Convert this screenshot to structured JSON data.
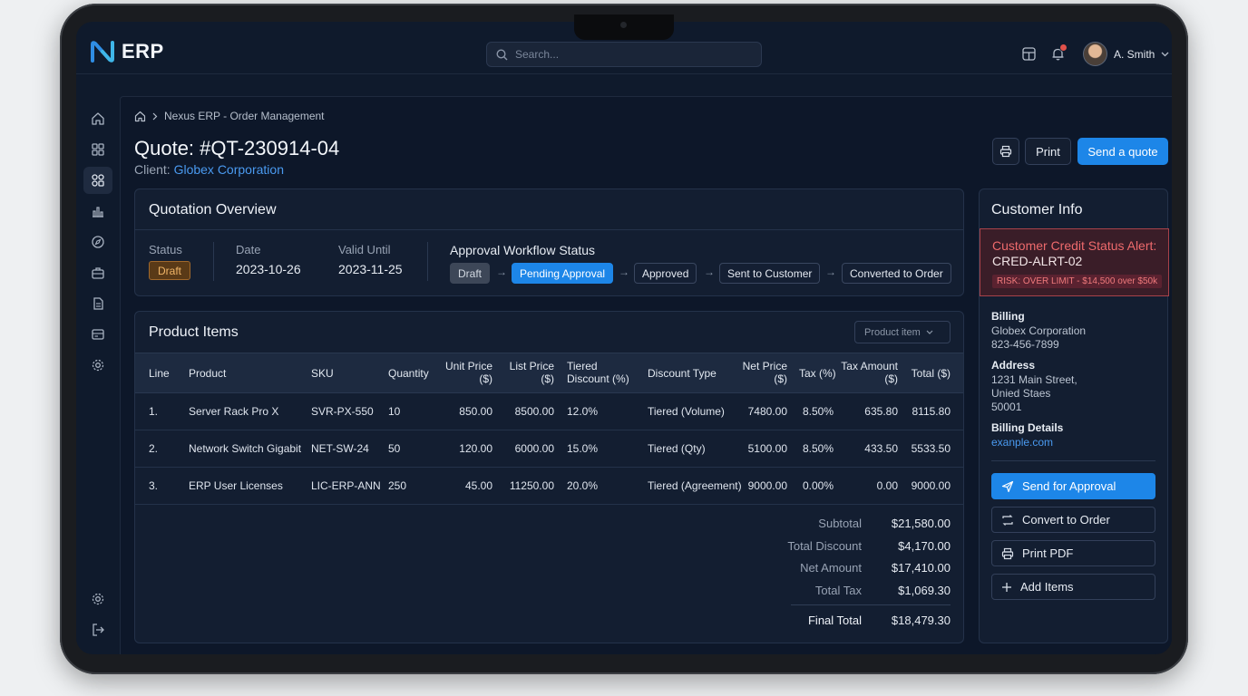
{
  "app": {
    "logo_text": "ERP"
  },
  "search": {
    "placeholder": "Search..."
  },
  "user": {
    "name": "A. Smith"
  },
  "breadcrumb": {
    "label": "Nexus ERP - Order Management"
  },
  "quote": {
    "title": "Quote: #QT-230914-04",
    "client_label": "Client:",
    "client_name": "Globex Corporation"
  },
  "header_actions": {
    "print": "Print",
    "send": "Send a quote"
  },
  "overview": {
    "title": "Quotation Overview",
    "status_label": "Status",
    "status_value": "Draft",
    "date_label": "Date",
    "date_value": "2023-10-26",
    "valid_label": "Valid Until",
    "valid_value": "2023-11-25",
    "workflow_title": "Approval Workflow Status",
    "workflow_steps": [
      "Draft",
      "Pending Approval",
      "Approved",
      "Sent to Customer",
      "Converted to Order"
    ],
    "workflow_current": "Pending Approval"
  },
  "items": {
    "title": "Product Items",
    "dropdown_label": "Product item",
    "columns": [
      "Line",
      "Product",
      "SKU",
      "Quantity",
      "Unit Price ($)",
      "List Price ($)",
      "Tiered Discount (%)",
      "Discount Type",
      "Net Price ($)",
      "Tax (%)",
      "Tax Amount ($)",
      "Total ($)"
    ],
    "rows": [
      [
        "1.",
        "Server Rack Pro X",
        "SVR-PX-550",
        "10",
        "850.00",
        "8500.00",
        "12.0%",
        "Tiered (Volume)",
        "7480.00",
        "8.50%",
        "635.80",
        "8115.80"
      ],
      [
        "2.",
        "Network Switch Gigabit",
        "NET-SW-24",
        "50",
        "120.00",
        "6000.00",
        "15.0%",
        "Tiered (Qty)",
        "5100.00",
        "8.50%",
        "433.50",
        "5533.50"
      ],
      [
        "3.",
        "ERP User Licenses",
        "LIC-ERP-ANN",
        "250",
        "45.00",
        "11250.00",
        "20.0%",
        "Tiered (Agreement)",
        "9000.00",
        "0.00%",
        "0.00",
        "9000.00"
      ]
    ],
    "summary": {
      "subtotal_label": "Subtotal",
      "subtotal": "$21,580.00",
      "discount_label": "Total Discount",
      "discount": "$4,170.00",
      "net_label": "Net Amount",
      "net": "$17,410.00",
      "tax_label": "Total Tax",
      "tax": "$1,069.30",
      "final_label": "Final Total",
      "final": "$18,479.30"
    }
  },
  "customer": {
    "title": "Customer Info",
    "alert_title": "Customer Credit Status Alert:",
    "alert_code": "CRED-ALRT-02",
    "alert_risk": "RISK: OVER LIMIT - $14,500 over $50k",
    "billing_label": "Billing",
    "billing_name": "Globex Corporation",
    "billing_phone": "823-456-7899",
    "address_label": "Address",
    "address_line1": "1231 Main Street,",
    "address_line2": "Unied Staes",
    "address_line3": "50001",
    "billing_details_label": "Billing Details",
    "billing_details_link": "exanple.com",
    "actions": {
      "send_approval": "Send for Approval",
      "convert": "Convert to Order",
      "print_pdf": "Print PDF",
      "add_items": "Add Items"
    }
  },
  "colors": {
    "accent": "#1d86e8",
    "draft_badge": "#a0682b",
    "alert": "#a8424a",
    "link": "#4a9af0"
  },
  "icons": {
    "sidebar": [
      "home-icon",
      "grid-icon",
      "apps-icon",
      "chart-icon",
      "compass-icon",
      "briefcase-icon",
      "document-icon",
      "card-icon",
      "settings-icon"
    ],
    "sidebar_bottom": [
      "settings-icon",
      "logout-icon"
    ]
  }
}
